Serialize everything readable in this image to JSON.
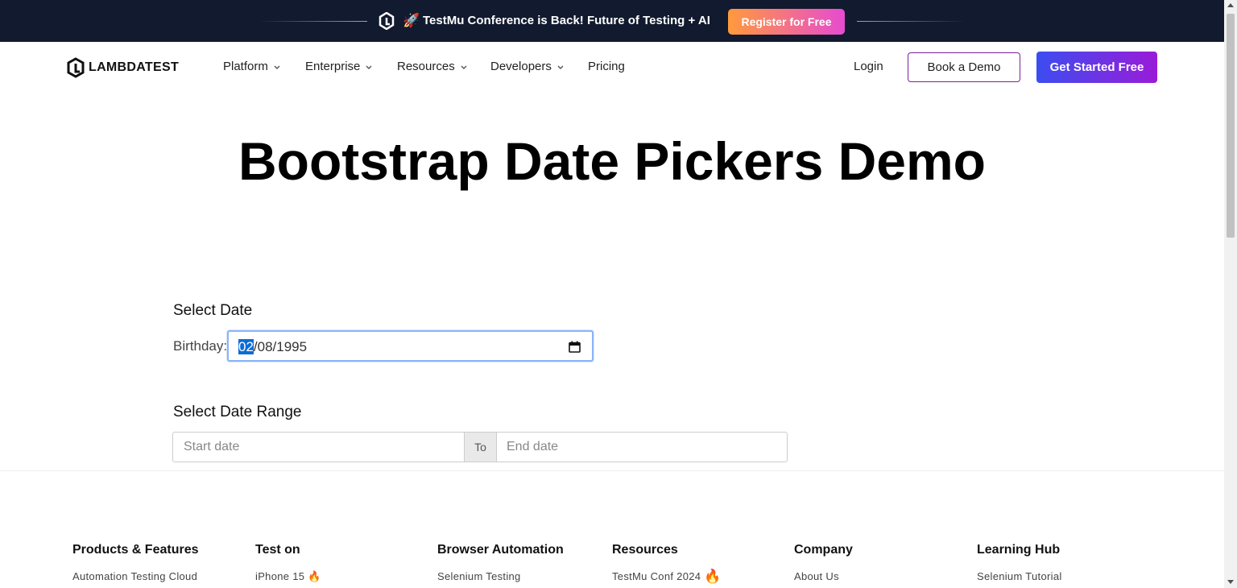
{
  "announcement": {
    "rocket": "🚀",
    "message": "TestMu Conference is Back! Future of Testing + AI",
    "register_label": "Register for Free"
  },
  "nav": {
    "brand": "LAMBDATEST",
    "items": [
      {
        "label": "Platform"
      },
      {
        "label": "Enterprise"
      },
      {
        "label": "Resources"
      },
      {
        "label": "Developers"
      },
      {
        "label": "Pricing"
      }
    ],
    "login_label": "Login",
    "book_demo_label": "Book a Demo",
    "get_started_label": "Get Started Free"
  },
  "page": {
    "title": "Bootstrap Date Pickers Demo"
  },
  "select_date": {
    "title": "Select Date",
    "birthday_label": "Birthday:",
    "month": "02",
    "rest": "/08/1995"
  },
  "date_range": {
    "title": "Select Date Range",
    "start_placeholder": "Start date",
    "to_label": "To",
    "end_placeholder": "End date"
  },
  "footer": {
    "columns": [
      {
        "heading": "Products & Features",
        "first_link": "Automation Testing Cloud"
      },
      {
        "heading": "Test on",
        "first_link": "iPhone 15",
        "emoji": "🔥"
      },
      {
        "heading": "Browser Automation",
        "first_link": "Selenium Testing"
      },
      {
        "heading": "Resources",
        "first_link": "TestMu Conf 2024",
        "emoji": "🔥"
      },
      {
        "heading": "Company",
        "first_link": "About Us"
      },
      {
        "heading": "Learning Hub",
        "first_link": "Selenium Tutorial"
      }
    ]
  },
  "colors": {
    "topbar_bg": "#111a2e",
    "register_gradient": [
      "#ff9a3c",
      "#e74bd1"
    ],
    "cta_gradient": [
      "#3b4df0",
      "#9a1cd8"
    ],
    "demo_border": "#7b1fa2",
    "focus_border": "#8ab4f8"
  }
}
